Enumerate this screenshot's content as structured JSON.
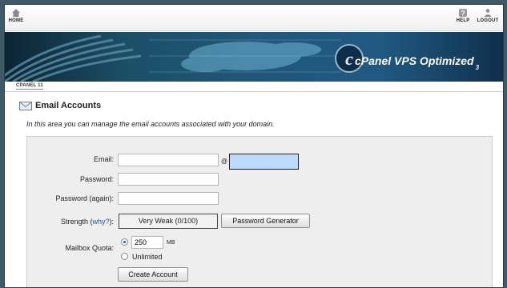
{
  "nav": {
    "home_label": "HOME",
    "help_label": "HELP",
    "logout_label": "LOGOUT"
  },
  "banner": {
    "brand_main": "cPanel",
    "brand_tagline": "VPS Optimized",
    "brand_version": "3"
  },
  "breadcrumb": {
    "label": "CPANEL 11"
  },
  "page": {
    "title": "Email Accounts",
    "intro": "In this area you can manage the email accounts associated with your domain."
  },
  "form": {
    "email_label": "Email:",
    "email_value": "",
    "at_symbol": "@",
    "domain_value": "",
    "password_label": "Password:",
    "password_value": "",
    "password_again_label": "Password (again):",
    "password_again_value": "",
    "strength_label": "Strength",
    "strength_open_paren": "(",
    "strength_why": "why?",
    "strength_close": "):",
    "strength_value": "Very Weak (0/100)",
    "password_generator_label": "Password Generator",
    "quota_label": "Mailbox Quota:",
    "quota_value": "250",
    "quota_unit": "MB",
    "unlimited_label": "Unlimited",
    "quota_selected": "limited",
    "create_button_label": "Create Account"
  },
  "colors": {
    "domain_highlight": "#bcd9ff",
    "link": "#1a56a8",
    "panel_bg": "#eeeeee"
  }
}
